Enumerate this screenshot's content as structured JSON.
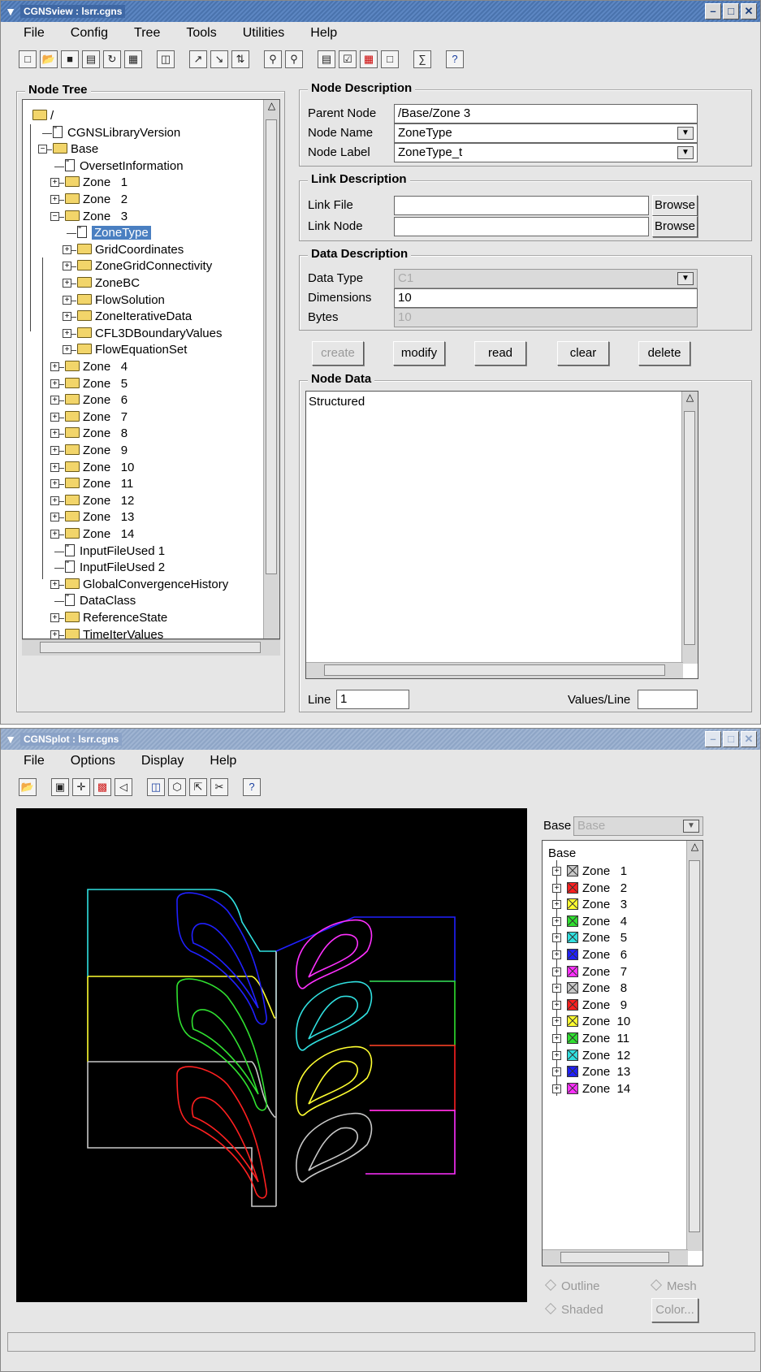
{
  "cgnsview": {
    "title": "CGNSview : lsrr.cgns",
    "menu": [
      "File",
      "Config",
      "Tree",
      "Tools",
      "Utilities",
      "Help"
    ],
    "node_tree": {
      "title": "Node Tree",
      "items": [
        "/",
        "CGNSLibraryVersion",
        "Base",
        "OversetInformation",
        "Zone   1",
        "Zone   2",
        "Zone   3",
        "ZoneType",
        "GridCoordinates",
        "ZoneGridConnectivity",
        "ZoneBC",
        "FlowSolution",
        "ZoneIterativeData",
        "CFL3DBoundaryValues",
        "FlowEquationSet",
        "Zone   4",
        "Zone   5",
        "Zone   6",
        "Zone   7",
        "Zone   8",
        "Zone   9",
        "Zone   10",
        "Zone   11",
        "Zone   12",
        "Zone   13",
        "Zone   14",
        "InputFileUsed 1",
        "InputFileUsed 2",
        "GlobalConvergenceHistory",
        "DataClass",
        "ReferenceState",
        "TimeIterValues"
      ]
    },
    "node_description": {
      "title": "Node Description",
      "parent_node_label": "Parent Node",
      "parent_node_value": "/Base/Zone   3",
      "node_name_label": "Node Name",
      "node_name_value": "ZoneType",
      "node_label_label": "Node Label",
      "node_label_value": "ZoneType_t"
    },
    "link_description": {
      "title": "Link Description",
      "link_file_label": "Link File",
      "link_file_value": "",
      "link_node_label": "Link Node",
      "link_node_value": "",
      "browse": "Browse"
    },
    "data_description": {
      "title": "Data Description",
      "data_type_label": "Data Type",
      "data_type_value": "C1",
      "dimensions_label": "Dimensions",
      "dimensions_value": "10",
      "bytes_label": "Bytes",
      "bytes_value": "10"
    },
    "actions": {
      "create": "create",
      "modify": "modify",
      "read": "read",
      "clear": "clear",
      "delete": "delete"
    },
    "node_data": {
      "title": "Node Data",
      "text": "Structured",
      "line_label": "Line",
      "line_value": "1",
      "values_per_line_label": "Values/Line",
      "values_per_line_value": ""
    }
  },
  "cgnsplot": {
    "title": "CGNSplot : lsrr.cgns",
    "menu": [
      "File",
      "Options",
      "Display",
      "Help"
    ],
    "base_label": "Base",
    "base_value": "Base",
    "tree_root": "Base",
    "zones": [
      {
        "name": "Zone   1",
        "color": "#c8c8c8"
      },
      {
        "name": "Zone   2",
        "color": "#ff2020"
      },
      {
        "name": "Zone   3",
        "color": "#ffff30"
      },
      {
        "name": "Zone   4",
        "color": "#30e030"
      },
      {
        "name": "Zone   5",
        "color": "#30e0e0"
      },
      {
        "name": "Zone   6",
        "color": "#2020ff"
      },
      {
        "name": "Zone   7",
        "color": "#ff30ff"
      },
      {
        "name": "Zone   8",
        "color": "#c8c8c8"
      },
      {
        "name": "Zone   9",
        "color": "#ff2020"
      },
      {
        "name": "Zone  10",
        "color": "#ffff30"
      },
      {
        "name": "Zone  11",
        "color": "#30e030"
      },
      {
        "name": "Zone  12",
        "color": "#30e0e0"
      },
      {
        "name": "Zone  13",
        "color": "#2020ff"
      },
      {
        "name": "Zone  14",
        "color": "#ff30ff"
      }
    ],
    "radio_outline": "Outline",
    "radio_mesh": "Mesh",
    "radio_shaded": "Shaded",
    "color_button": "Color..."
  }
}
